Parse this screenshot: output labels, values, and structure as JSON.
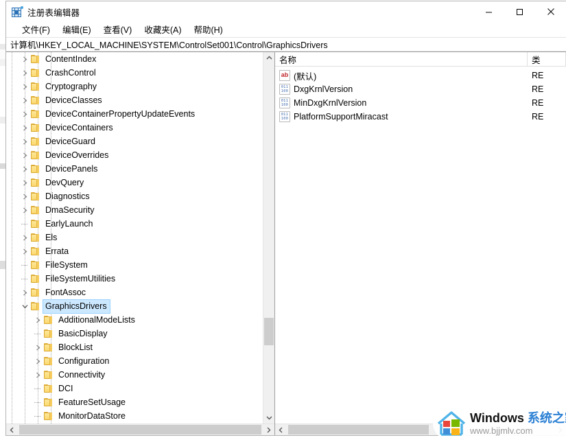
{
  "window": {
    "title": "注册表编辑器",
    "icon": "registry-editor-icon",
    "controls": {
      "minimize": "—",
      "maximize": "▢",
      "close": "✕"
    }
  },
  "menubar": {
    "items": [
      {
        "label": "文件(F)"
      },
      {
        "label": "编辑(E)"
      },
      {
        "label": "查看(V)"
      },
      {
        "label": "收藏夹(A)"
      },
      {
        "label": "帮助(H)"
      }
    ]
  },
  "address": {
    "path": "计算机\\HKEY_LOCAL_MACHINE\\SYSTEM\\ControlSet001\\Control\\GraphicsDrivers"
  },
  "tree": {
    "rows": [
      {
        "label": "ContentIndex",
        "indent": 1,
        "expandable": true,
        "expanded": false,
        "selected": false
      },
      {
        "label": "CrashControl",
        "indent": 1,
        "expandable": true,
        "expanded": false,
        "selected": false
      },
      {
        "label": "Cryptography",
        "indent": 1,
        "expandable": true,
        "expanded": false,
        "selected": false
      },
      {
        "label": "DeviceClasses",
        "indent": 1,
        "expandable": true,
        "expanded": false,
        "selected": false
      },
      {
        "label": "DeviceContainerPropertyUpdateEvents",
        "indent": 1,
        "expandable": true,
        "expanded": false,
        "selected": false
      },
      {
        "label": "DeviceContainers",
        "indent": 1,
        "expandable": true,
        "expanded": false,
        "selected": false
      },
      {
        "label": "DeviceGuard",
        "indent": 1,
        "expandable": true,
        "expanded": false,
        "selected": false
      },
      {
        "label": "DeviceOverrides",
        "indent": 1,
        "expandable": true,
        "expanded": false,
        "selected": false
      },
      {
        "label": "DevicePanels",
        "indent": 1,
        "expandable": true,
        "expanded": false,
        "selected": false
      },
      {
        "label": "DevQuery",
        "indent": 1,
        "expandable": true,
        "expanded": false,
        "selected": false
      },
      {
        "label": "Diagnostics",
        "indent": 1,
        "expandable": true,
        "expanded": false,
        "selected": false
      },
      {
        "label": "DmaSecurity",
        "indent": 1,
        "expandable": true,
        "expanded": false,
        "selected": false
      },
      {
        "label": "EarlyLaunch",
        "indent": 1,
        "expandable": false,
        "expanded": false,
        "selected": false
      },
      {
        "label": "Els",
        "indent": 1,
        "expandable": true,
        "expanded": false,
        "selected": false
      },
      {
        "label": "Errata",
        "indent": 1,
        "expandable": true,
        "expanded": false,
        "selected": false
      },
      {
        "label": "FileSystem",
        "indent": 1,
        "expandable": false,
        "expanded": false,
        "selected": false
      },
      {
        "label": "FileSystemUtilities",
        "indent": 1,
        "expandable": false,
        "expanded": false,
        "selected": false
      },
      {
        "label": "FontAssoc",
        "indent": 1,
        "expandable": true,
        "expanded": false,
        "selected": false
      },
      {
        "label": "GraphicsDrivers",
        "indent": 1,
        "expandable": true,
        "expanded": true,
        "selected": true
      },
      {
        "label": "AdditionalModeLists",
        "indent": 2,
        "expandable": true,
        "expanded": false,
        "selected": false
      },
      {
        "label": "BasicDisplay",
        "indent": 2,
        "expandable": false,
        "expanded": false,
        "selected": false
      },
      {
        "label": "BlockList",
        "indent": 2,
        "expandable": true,
        "expanded": false,
        "selected": false
      },
      {
        "label": "Configuration",
        "indent": 2,
        "expandable": true,
        "expanded": false,
        "selected": false
      },
      {
        "label": "Connectivity",
        "indent": 2,
        "expandable": true,
        "expanded": false,
        "selected": false
      },
      {
        "label": "DCI",
        "indent": 2,
        "expandable": false,
        "expanded": false,
        "selected": false
      },
      {
        "label": "FeatureSetUsage",
        "indent": 2,
        "expandable": false,
        "expanded": false,
        "selected": false
      },
      {
        "label": "MonitorDataStore",
        "indent": 2,
        "expandable": false,
        "expanded": false,
        "selected": false
      }
    ],
    "scroll": {
      "up": "▲",
      "down": "▼",
      "left": "‹",
      "right": "›"
    }
  },
  "values": {
    "columns": [
      {
        "key": "name",
        "label": "名称"
      },
      {
        "key": "type",
        "label": "类"
      }
    ],
    "rows": [
      {
        "name": "(默认)",
        "type": "RE",
        "icon": "string-value-icon"
      },
      {
        "name": "DxgKrnlVersion",
        "type": "RE",
        "icon": "dword-value-icon"
      },
      {
        "name": "MinDxgKrnlVersion",
        "type": "RE",
        "icon": "dword-value-icon"
      },
      {
        "name": "PlatformSupportMiracast",
        "type": "RE",
        "icon": "dword-value-icon"
      }
    ],
    "scroll": {
      "left": "‹",
      "right": "›"
    }
  },
  "watermark": {
    "brand": "Windows ",
    "brand_cn": "系统之家",
    "url": "www.bjjmlv.com"
  },
  "colors": {
    "selection": "#cce8ff",
    "folder": "#fcd96f",
    "accent": "#2a7fd4",
    "string_icon": "#c1272d",
    "dword_icon": "#2f5fa8"
  }
}
